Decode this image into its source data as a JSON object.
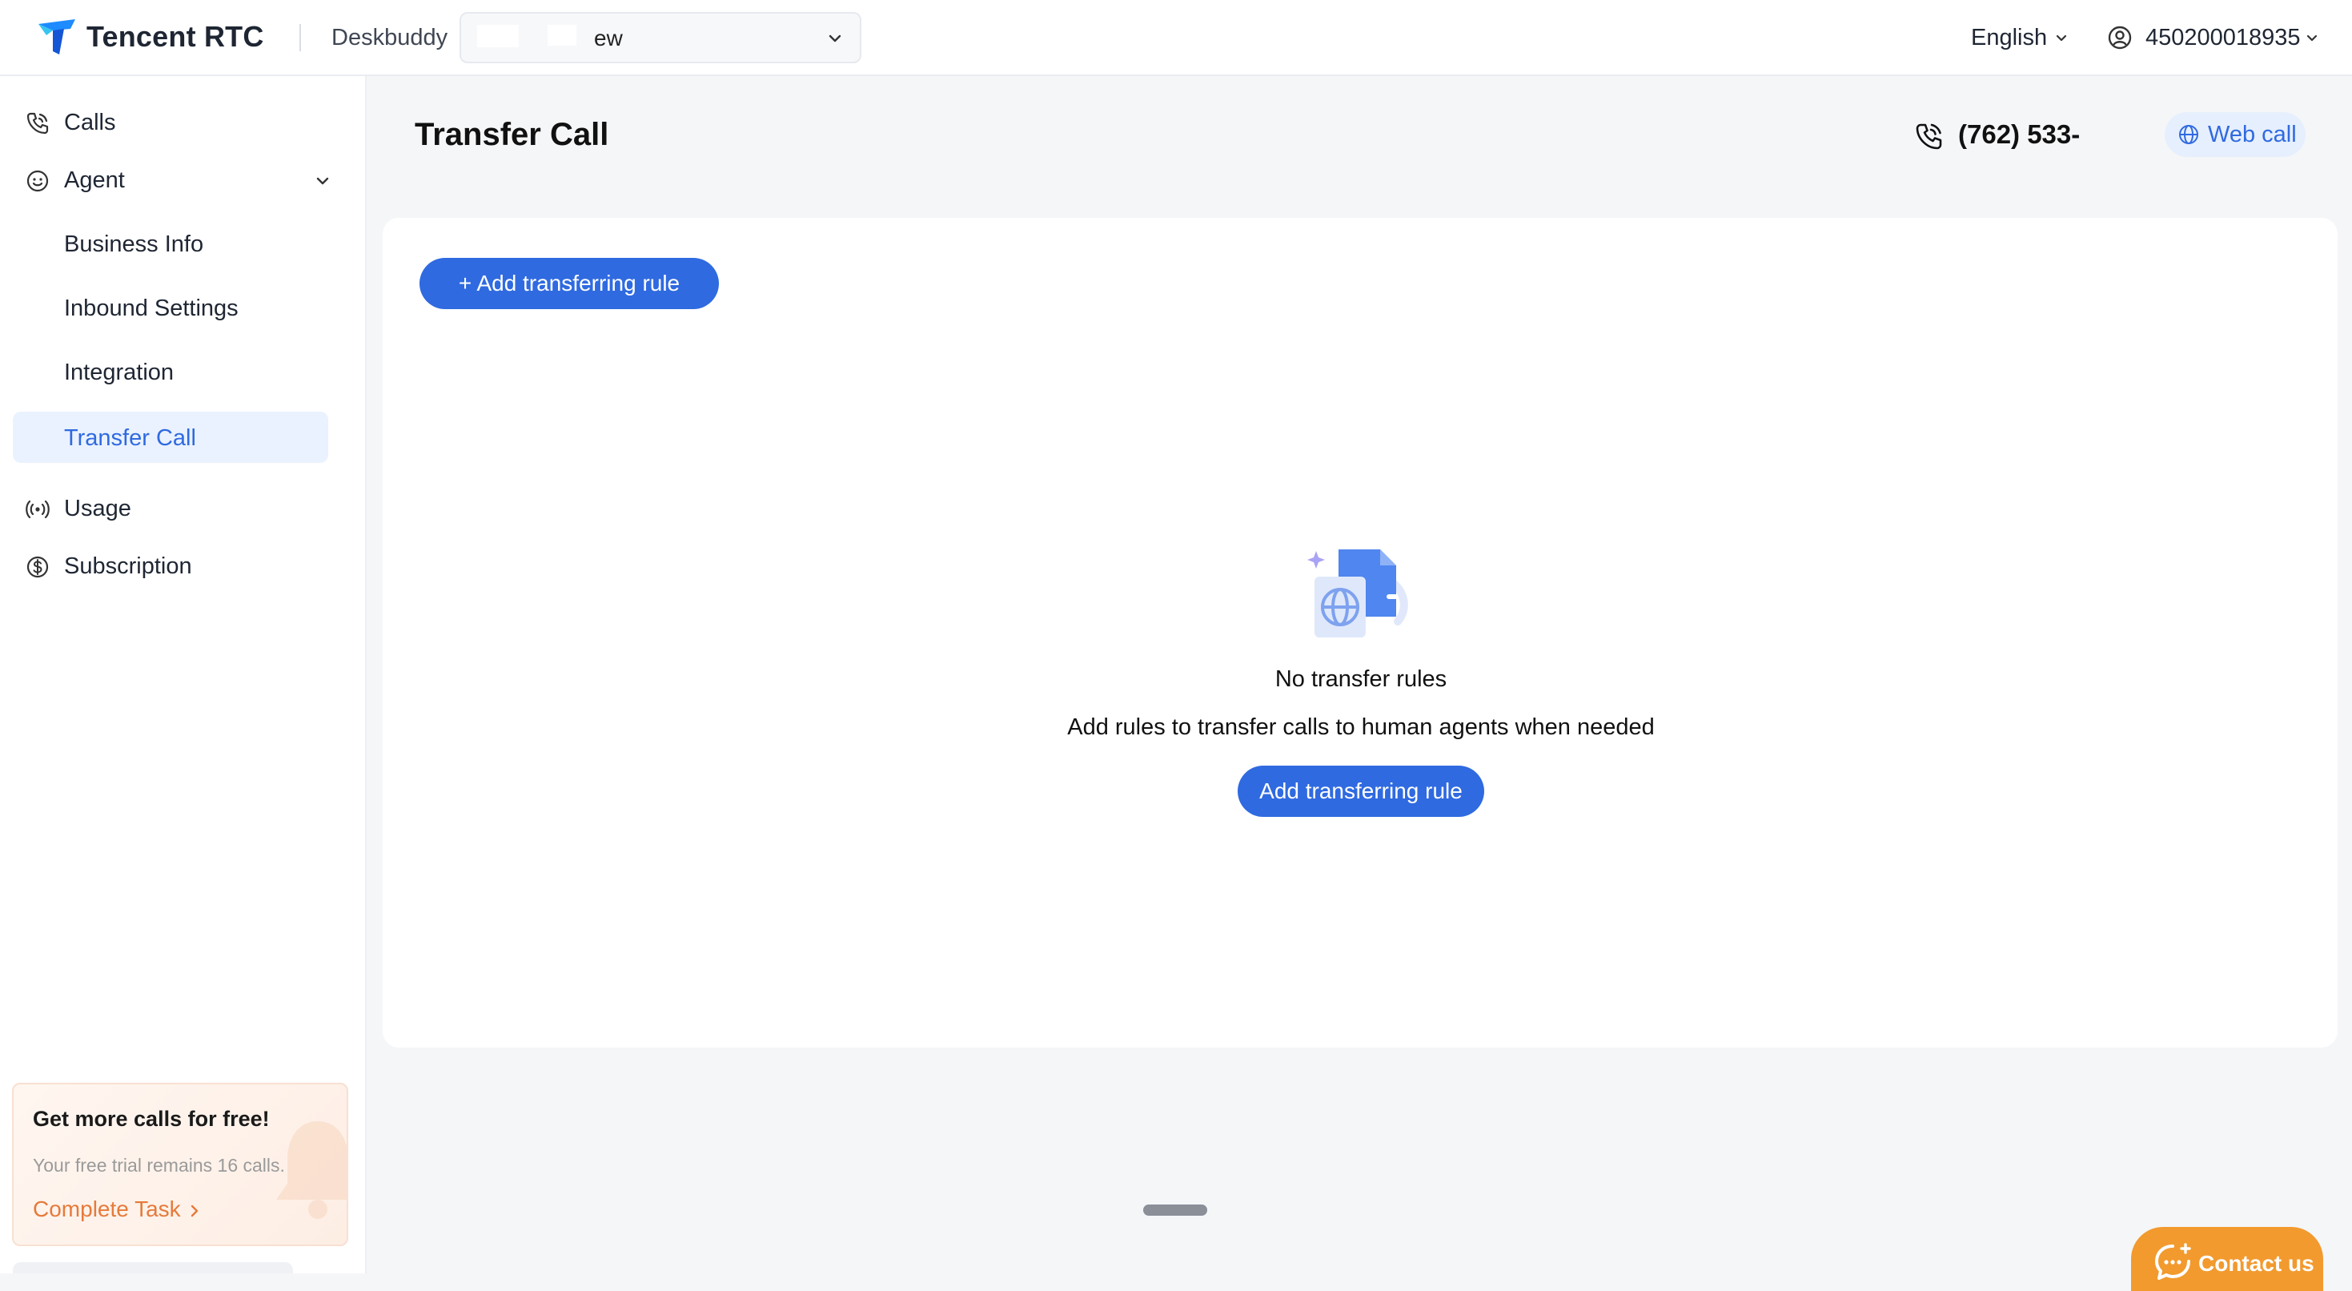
{
  "header": {
    "brand": "Tencent RTC",
    "app_name": "Deskbuddy",
    "project_value": "ew",
    "language": "English",
    "account_id": "450200018935"
  },
  "sidebar": {
    "items": [
      {
        "label": "Calls",
        "icon": "phone-call-icon"
      },
      {
        "label": "Agent",
        "icon": "agent-face-icon"
      },
      {
        "label": "Usage",
        "icon": "broadcast-icon"
      },
      {
        "label": "Subscription",
        "icon": "dollar-circle-icon"
      }
    ],
    "agent_subitems": [
      {
        "label": "Business Info",
        "active": false
      },
      {
        "label": "Inbound Settings",
        "active": false
      },
      {
        "label": "Integration",
        "active": false
      },
      {
        "label": "Transfer Call",
        "active": true
      }
    ],
    "promo": {
      "title": "Get more calls for free!",
      "subtitle": "Your free trial remains 16 calls.",
      "link": "Complete Task"
    }
  },
  "main": {
    "title": "Transfer Call",
    "phone_number": "(762) 533-",
    "web_call_label": "Web call",
    "add_rule_top_label": "+ Add transferring rule",
    "empty_state": {
      "title": "No transfer rules",
      "description": "Add rules to transfer calls to human agents when needed",
      "button_label": "Add transferring rule"
    }
  },
  "contact": {
    "label": "Contact us"
  },
  "colors": {
    "accent": "#2f6ae0",
    "accent_light": "#eaf2ff",
    "contact_orange": "#f29a2e",
    "promo_link": "#e67a3a"
  }
}
